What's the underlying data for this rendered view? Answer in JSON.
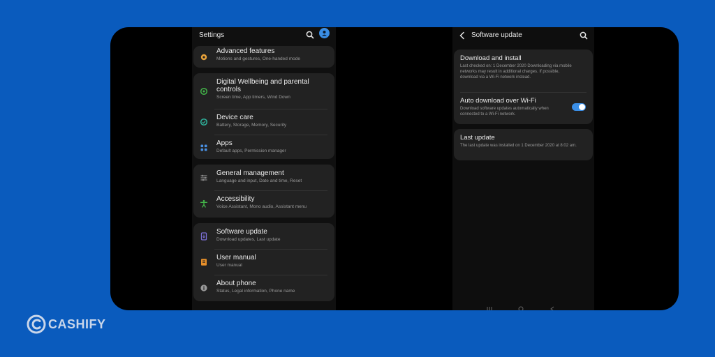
{
  "settings": {
    "title": "Settings",
    "groups": [
      {
        "items": [
          {
            "title": "Advanced features",
            "subtitle": "Motions and gestures, One-handed mode",
            "icon": "gear-star-icon",
            "color": "#e8a23a"
          }
        ]
      },
      {
        "items": [
          {
            "title": "Digital Wellbeing and parental controls",
            "subtitle": "Screen time, App timers, Wind Down",
            "icon": "wellbeing-icon",
            "color": "#43b549"
          },
          {
            "title": "Device care",
            "subtitle": "Battery, Storage, Memory, Security",
            "icon": "device-care-icon",
            "color": "#2fb59e"
          },
          {
            "title": "Apps",
            "subtitle": "Default apps, Permission manager",
            "icon": "apps-grid-icon",
            "color": "#4a90e2"
          }
        ]
      },
      {
        "items": [
          {
            "title": "General management",
            "subtitle": "Language and input, Date and time, Reset",
            "icon": "sliders-icon",
            "color": "#8a8a8a"
          },
          {
            "title": "Accessibility",
            "subtitle": "Voice Assistant, Mono audio, Assistant menu",
            "icon": "accessibility-icon",
            "color": "#43b549"
          }
        ]
      },
      {
        "items": [
          {
            "title": "Software update",
            "subtitle": "Download updates, Last update",
            "icon": "software-update-icon",
            "color": "#7b6fd6"
          },
          {
            "title": "User manual",
            "subtitle": "User manual",
            "icon": "manual-icon",
            "color": "#e8902a"
          },
          {
            "title": "About phone",
            "subtitle": "Status, Legal information, Phone name",
            "icon": "info-icon",
            "color": "#9a9a9a"
          }
        ]
      }
    ]
  },
  "software_update": {
    "title": "Software update",
    "download": {
      "title": "Download and install",
      "subtitle": "Last checked on: 1 December 2020 Downloading via mobile networks may result in additional charges. If possible, download via a Wi-Fi network instead."
    },
    "auto_download": {
      "title": "Auto download over Wi-Fi",
      "subtitle": "Download software updates automatically when connected to a Wi-Fi network.",
      "enabled": true
    },
    "last_update": {
      "title": "Last update",
      "subtitle": "The last update was installed on 1 December 2020 at 8:02 am."
    }
  },
  "brand": {
    "name": "CASHIFY",
    "background": "#0a5bbd",
    "accent": "#3a8ee6"
  }
}
